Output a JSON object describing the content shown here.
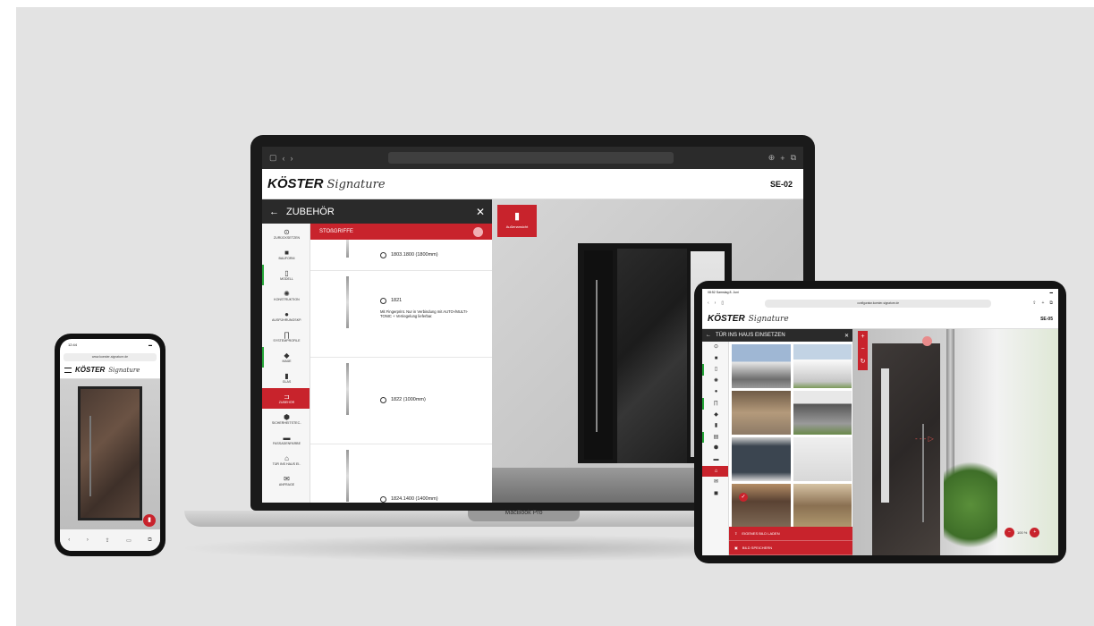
{
  "brand": {
    "name": "KÖSTER",
    "signature": "Signature"
  },
  "laptop": {
    "model_code": "SE-02",
    "device_label": "MacBook Pro",
    "panel_title": "ZUBEHÖR",
    "back_icon": "arrow-left-icon",
    "close_icon": "close-icon",
    "subsection": "STOßGRIFFE",
    "view_button": "Außenansicht",
    "nav": [
      {
        "label": "ZURÜCKSETZEN",
        "icon": "reset-icon",
        "state": ""
      },
      {
        "label": "BAUFORM",
        "icon": "shape-icon",
        "state": ""
      },
      {
        "label": "MODELL",
        "icon": "door-icon",
        "state": "done"
      },
      {
        "label": "KONSTRUKTION",
        "icon": "gear-icon",
        "state": ""
      },
      {
        "label": "AUSFÜHRUNGSKP.",
        "icon": "palette-icon",
        "state": ""
      },
      {
        "label": "SYSTEMPROFILE",
        "icon": "profile-icon",
        "state": ""
      },
      {
        "label": "MAßE",
        "icon": "ruler-icon",
        "state": "done"
      },
      {
        "label": "GLAS",
        "icon": "glass-icon",
        "state": ""
      },
      {
        "label": "ZUBEHÖR",
        "icon": "handle-icon",
        "state": "active"
      },
      {
        "label": "SICHERHEITSTEC..",
        "icon": "lock-icon",
        "state": ""
      },
      {
        "label": "FASSADENFARBE",
        "icon": "facade-icon",
        "state": ""
      },
      {
        "label": "TÜR INS HAUS EI..",
        "icon": "house-icon",
        "state": ""
      },
      {
        "label": "ANFRAGE",
        "icon": "mail-icon",
        "state": ""
      }
    ],
    "handles": [
      {
        "label": "1803.1800 (1800mm)",
        "desc": ""
      },
      {
        "label": "1821",
        "desc": "Mit Fingerprint. Nur in Verbindung mit AUTO-/MULTI-TONIC + Verriegelung lieferbar."
      },
      {
        "label": "1822 (1000mm)",
        "desc": ""
      },
      {
        "label": "1824.1400 (1400mm)",
        "desc": ""
      }
    ]
  },
  "phone": {
    "time": "12:44",
    "url": "www.koester-signature.de"
  },
  "tablet": {
    "time": "08:52",
    "date": "Samstag 8. Juni",
    "url": "configurator.koester-signature.de",
    "model_code": "SE-05",
    "panel_title": "TÜR INS HAUS EINSETZEN",
    "actions": [
      {
        "label": "EIGENES BILD LADEN",
        "icon": "upload-icon"
      },
      {
        "label": "BILD SPEICHERN",
        "icon": "save-icon"
      }
    ],
    "zoom": "100 %"
  }
}
